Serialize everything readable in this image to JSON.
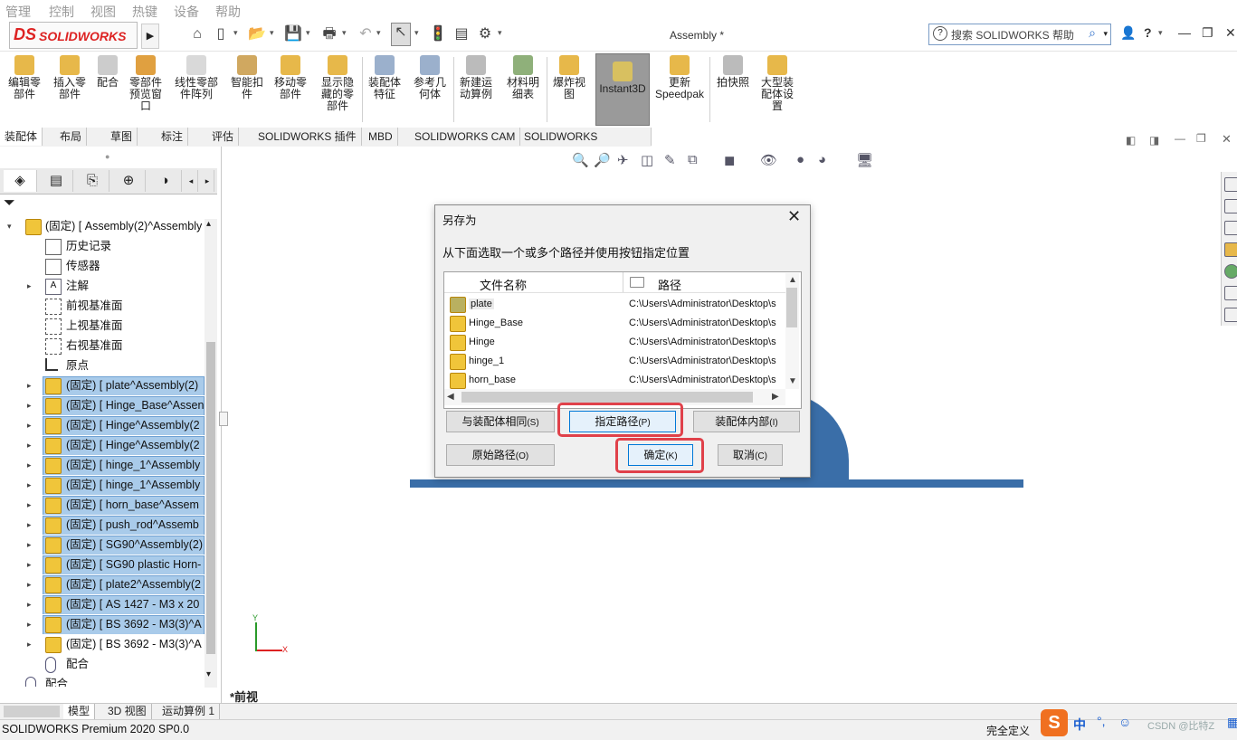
{
  "menubar": {
    "items": [
      "管理",
      "控制",
      "视图",
      "热键",
      "设备",
      "帮助"
    ]
  },
  "titlebar": {
    "logo_ds": "DS",
    "logo_text": "SOLIDWORKS",
    "doc_title": "Assembly *",
    "search_placeholder": "搜索 SOLIDWORKS 帮助",
    "help_q": "?",
    "caret": "▾"
  },
  "command_manager": {
    "commands": [
      {
        "label": "编辑零\n部件"
      },
      {
        "label": "插入零\n部件"
      },
      {
        "label": "配合"
      },
      {
        "label": "零部件\n预览窗\n口"
      },
      {
        "label": "线性零部\n件阵列"
      },
      {
        "label": "智能扣\n件"
      },
      {
        "label": "移动零\n部件"
      },
      {
        "label": "显示隐\n藏的零\n部件"
      },
      {
        "label": "装配体\n特征"
      },
      {
        "label": "参考几\n何体"
      },
      {
        "label": "新建运\n动算例"
      },
      {
        "label": "材料明\n细表"
      },
      {
        "label": "爆炸视\n图"
      },
      {
        "label": "Instant3D"
      },
      {
        "label": "更新\nSpeedpak"
      },
      {
        "label": "拍快照"
      },
      {
        "label": "大型装\n配体设\n置"
      }
    ]
  },
  "tabs": [
    "装配体",
    "布局",
    "草图",
    "标注",
    "评估",
    "SOLIDWORKS 插件",
    "MBD",
    "SOLIDWORKS CAM",
    "SOLIDWORKS Inspection"
  ],
  "tree": {
    "root": "(固定) [ Assembly(2)^Assembly",
    "items": [
      {
        "label": "历史记录"
      },
      {
        "label": "传感器"
      },
      {
        "label": "注解"
      },
      {
        "label": "前视基准面"
      },
      {
        "label": "上视基准面"
      },
      {
        "label": "右视基准面"
      },
      {
        "label": "原点"
      },
      {
        "label": "(固定) [ plate^Assembly(2)"
      },
      {
        "label": "(固定) [ Hinge_Base^Assen"
      },
      {
        "label": "(固定) [ Hinge^Assembly(2"
      },
      {
        "label": "(固定) [ Hinge^Assembly(2"
      },
      {
        "label": "(固定) [ hinge_1^Assembly"
      },
      {
        "label": "(固定) [ hinge_1^Assembly"
      },
      {
        "label": "(固定) [ horn_base^Assem"
      },
      {
        "label": "(固定) [ push_rod^Assemb"
      },
      {
        "label": "(固定) [ SG90^Assembly(2)"
      },
      {
        "label": "(固定) [ SG90 plastic Horn-"
      },
      {
        "label": "(固定) [ plate2^Assembly(2"
      },
      {
        "label": "(固定) [ AS 1427 - M3 x 20"
      },
      {
        "label": "(固定) [ BS 3692 - M3(3)^A"
      },
      {
        "label": "(固定) [ BS 3692 - M3(3)^A"
      },
      {
        "label": "配合"
      },
      {
        "label": "配合"
      }
    ]
  },
  "graphics": {
    "view_label": "*前视",
    "axis_y": "Y",
    "axis_x": "X"
  },
  "bottom_tabs": [
    "模型",
    "3D 视图",
    "运动算例 1"
  ],
  "status": {
    "left": "SOLIDWORKS Premium 2020 SP0.0",
    "right": "完全定义",
    "ime": "中",
    "watermark": "CSDN @比特Z"
  },
  "dialog": {
    "title": "另存为",
    "close": "✕",
    "instruction": "从下面选取一个或多个路径并使用按钮指定位置",
    "col_name": "文件名称",
    "col_path": "路径",
    "files": [
      {
        "name": "plate",
        "path": "C:\\Users\\Administrator\\Desktop\\s"
      },
      {
        "name": "Hinge_Base",
        "path": "C:\\Users\\Administrator\\Desktop\\s"
      },
      {
        "name": "Hinge",
        "path": "C:\\Users\\Administrator\\Desktop\\s"
      },
      {
        "name": "hinge_1",
        "path": "C:\\Users\\Administrator\\Desktop\\s"
      },
      {
        "name": "horn_base",
        "path": "C:\\Users\\Administrator\\Desktop\\s"
      }
    ],
    "buttons": {
      "same_as_assembly": "与装配体相同",
      "same_as_assembly_key": "(S)",
      "specify_path": "指定路径",
      "specify_path_key": "(P)",
      "inside_assembly": "装配体内部",
      "inside_assembly_key": "(I)",
      "original_path": "原始路径",
      "original_path_key": "(O)",
      "ok": "确定",
      "ok_key": "(K)",
      "cancel": "取消",
      "cancel_key": "(C)"
    },
    "highlight_color": "#e0414a"
  }
}
